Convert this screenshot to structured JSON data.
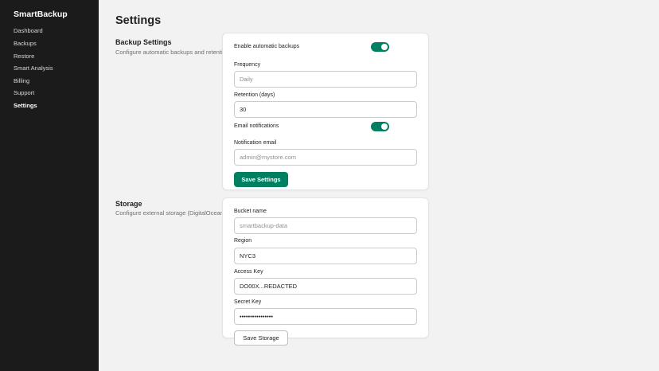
{
  "sidebar": {
    "brand": "SmartBackup",
    "items": [
      {
        "label": "Dashboard"
      },
      {
        "label": "Backups"
      },
      {
        "label": "Restore"
      },
      {
        "label": "Smart Analysis"
      },
      {
        "label": "Billing"
      },
      {
        "label": "Support"
      },
      {
        "label": "Settings",
        "active": true
      }
    ]
  },
  "page": {
    "title": "Settings"
  },
  "backup": {
    "title": "Backup Settings",
    "description": "Configure automatic backups and retention",
    "enable_label": "Enable automatic backups",
    "enable_on": true,
    "frequency_label": "Frequency",
    "frequency_placeholder": "Daily",
    "retention_label": "Retention (days)",
    "retention_value": "30",
    "email_notif_label": "Email notifications",
    "email_notif_on": true,
    "notif_email_label": "Notification email",
    "notif_email_placeholder": "admin@mystore.com",
    "save_label": "Save Settings"
  },
  "storage": {
    "title": "Storage",
    "description": "Configure external storage (DigitalOcean Spaces)",
    "bucket_label": "Bucket name",
    "bucket_placeholder": "smartbackup-data",
    "region_label": "Region",
    "region_value": "NYC3",
    "access_label": "Access Key",
    "access_value": "DO00X...REDACTED",
    "secret_label": "Secret Key",
    "secret_value": "••••••••••••••••",
    "save_label": "Save Storage"
  },
  "colors": {
    "accent": "#008060",
    "sidebar_bg": "#1b1b1b",
    "page_bg": "#f2f2f3"
  }
}
